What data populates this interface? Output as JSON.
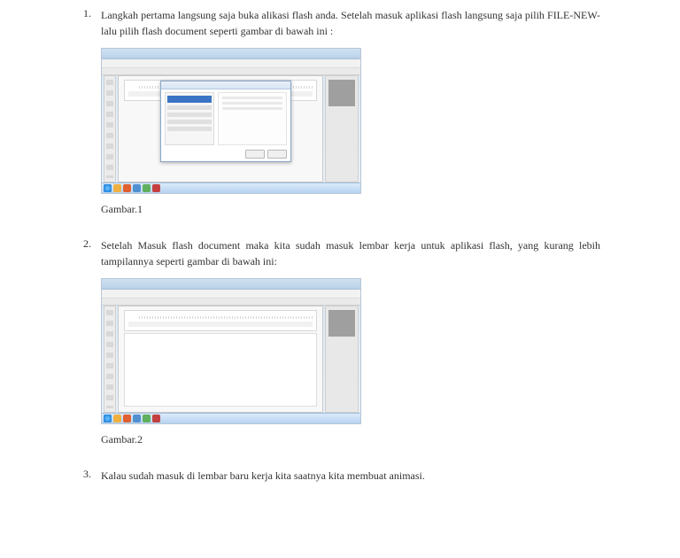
{
  "items": [
    {
      "num": "1.",
      "text": "Langkah pertama langsung saja buka alikasi flash anda. Setelah masuk aplikasi flash langsung saja pilih FILE-NEW- lalu pilih flash document seperti gambar di bawah ini :",
      "caption": "Gambar.1"
    },
    {
      "num": "2.",
      "text": "Setelah Masuk flash document maka kita sudah masuk lembar kerja untuk aplikasi flash, yang kurang lebih tampilannya seperti gambar di bawah ini:",
      "caption": "Gambar.2"
    },
    {
      "num": "3.",
      "text": "Kalau sudah masuk di lembar baru kerja kita saatnya kita membuat animasi."
    }
  ]
}
